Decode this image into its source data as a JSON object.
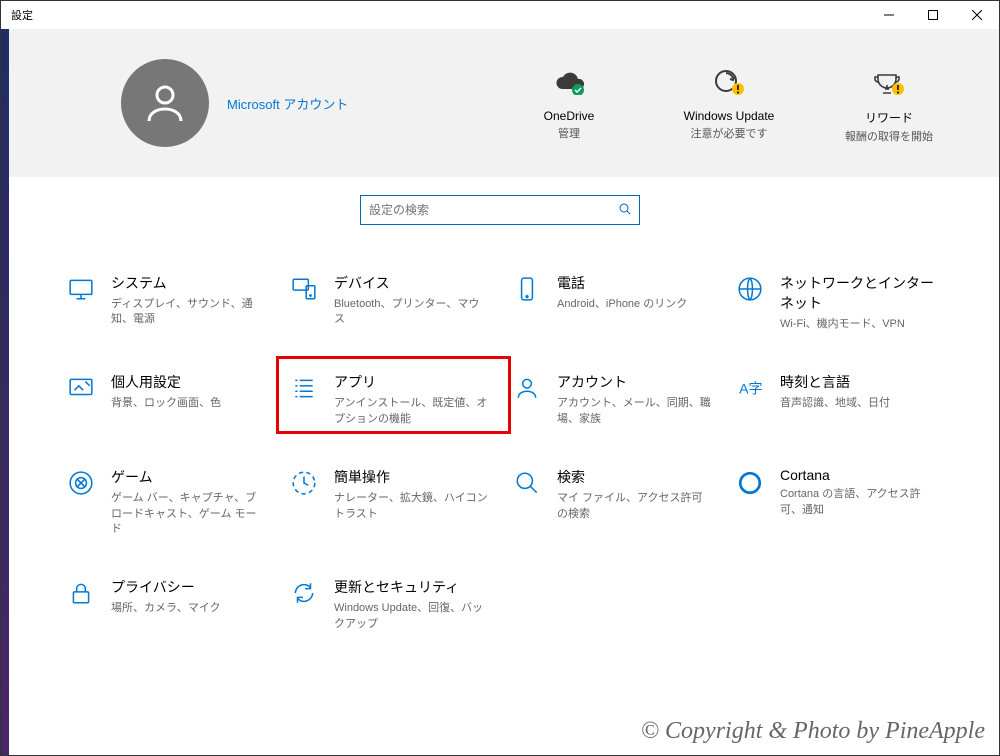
{
  "window": {
    "title": "設定"
  },
  "account": {
    "link_label": "Microsoft アカウント"
  },
  "status": [
    {
      "title": "OneDrive",
      "sub": "管理"
    },
    {
      "title": "Windows Update",
      "sub": "注意が必要です"
    },
    {
      "title": "リワード",
      "sub": "報酬の取得を開始"
    }
  ],
  "search": {
    "placeholder": "設定の検索"
  },
  "categories": [
    {
      "id": "system",
      "title": "システム",
      "sub": "ディスプレイ、サウンド、通知、電源"
    },
    {
      "id": "devices",
      "title": "デバイス",
      "sub": "Bluetooth、プリンター、マウス"
    },
    {
      "id": "phone",
      "title": "電話",
      "sub": "Android、iPhone のリンク"
    },
    {
      "id": "network",
      "title": "ネットワークとインターネット",
      "sub": "Wi-Fi、機内モード、VPN"
    },
    {
      "id": "personalize",
      "title": "個人用設定",
      "sub": "背景、ロック画面、色"
    },
    {
      "id": "apps",
      "title": "アプリ",
      "sub": "アンインストール、既定値、オプションの機能",
      "highlighted": true
    },
    {
      "id": "accounts",
      "title": "アカウント",
      "sub": "アカウント、メール、同期、職場、家族"
    },
    {
      "id": "time",
      "title": "時刻と言語",
      "sub": "音声認識、地域、日付"
    },
    {
      "id": "gaming",
      "title": "ゲーム",
      "sub": "ゲーム バー、キャプチャ、ブロードキャスト、ゲーム モード"
    },
    {
      "id": "ease",
      "title": "簡単操作",
      "sub": "ナレーター、拡大鏡、ハイコントラスト"
    },
    {
      "id": "search",
      "title": "検索",
      "sub": "マイ ファイル、アクセス許可の検索"
    },
    {
      "id": "cortana",
      "title": "Cortana",
      "sub": "Cortana の言語、アクセス許可、通知"
    },
    {
      "id": "privacy",
      "title": "プライバシー",
      "sub": "場所、カメラ、マイク"
    },
    {
      "id": "update",
      "title": "更新とセキュリティ",
      "sub": "Windows Update、回復、バックアップ"
    }
  ],
  "watermark": "© Copyright & Photo by PineApple"
}
